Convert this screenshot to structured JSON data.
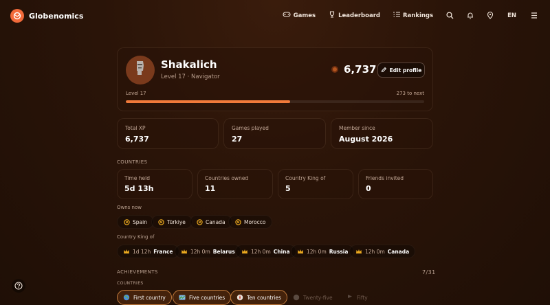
{
  "app": {
    "brand": "Globenomics"
  },
  "nav": {
    "games": "Games",
    "leaderboard": "Leaderboard",
    "rankings": "Rankings",
    "lang": "EN"
  },
  "profile": {
    "name": "Shakalich",
    "subtitle": "Level 17 · Navigator",
    "coins": "6,737",
    "edit_label": "Edit profile",
    "level_label": "Level 17",
    "to_next": "273 to next",
    "progress_fraction": 0.55
  },
  "stats": [
    {
      "label": "Total XP",
      "value": "6,737"
    },
    {
      "label": "Games played",
      "value": "27"
    },
    {
      "label": "Member since",
      "value": "August 2026"
    }
  ],
  "countries": {
    "title": "COUNTRIES",
    "stats": [
      {
        "label": "Time held",
        "value": "5d 13h"
      },
      {
        "label": "Countries owned",
        "value": "11"
      },
      {
        "label": "Country King of",
        "value": "5"
      },
      {
        "label": "Friends invited",
        "value": "0"
      }
    ],
    "owns_label": "Owns now",
    "owns": [
      "Spain",
      "Türkiye",
      "Canada",
      "Morocco"
    ],
    "king_label": "Country King of",
    "king": [
      {
        "time": "1d 12h",
        "country": "France"
      },
      {
        "time": "12h 0m",
        "country": "Belarus"
      },
      {
        "time": "12h 0m",
        "country": "China"
      },
      {
        "time": "12h 0m",
        "country": "Russia"
      },
      {
        "time": "12h 0m",
        "country": "Canada"
      }
    ]
  },
  "achievements": {
    "title": "ACHIEVEMENTS",
    "count": "7/31",
    "group": "COUNTRIES",
    "items": [
      {
        "label": "First country",
        "earned": true
      },
      {
        "label": "Five countries",
        "earned": true
      },
      {
        "label": "Ten countries",
        "earned": true
      },
      {
        "label": "Twenty-five",
        "earned": false
      },
      {
        "label": "Fifty",
        "earned": false
      }
    ]
  },
  "colors": {
    "accent": "#f0793a",
    "logo": "#f26a3a",
    "coin": "#b4561f",
    "chip_icon": "#e9a81f"
  }
}
